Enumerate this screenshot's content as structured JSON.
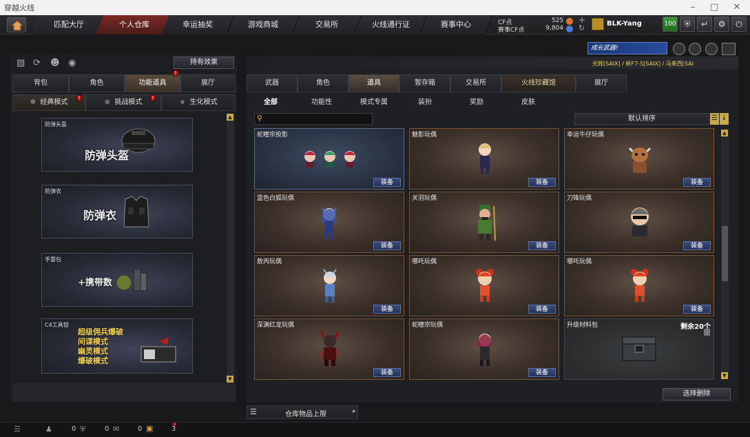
{
  "window": {
    "title": "穿越火线"
  },
  "topnav": {
    "tabs": [
      {
        "label": "匹配大厅"
      },
      {
        "label": "个人仓库"
      },
      {
        "label": "幸运抽奖"
      },
      {
        "label": "游戏商城"
      },
      {
        "label": "交易所"
      },
      {
        "label": "火线通行证"
      },
      {
        "label": "赛事中心"
      }
    ],
    "cf_label": "CF点",
    "cf_value": "525",
    "match_cf_label": "赛事CF点",
    "match_cf_value": "9,804",
    "username": "BLK-Yang",
    "level_badge": "100"
  },
  "left": {
    "effect_button": "持有效果",
    "tabs": [
      {
        "label": "背包"
      },
      {
        "label": "角色"
      },
      {
        "label": "功能道具"
      },
      {
        "label": "展厅"
      }
    ],
    "modes": [
      {
        "label": "经典模式"
      },
      {
        "label": "挑战模式"
      },
      {
        "label": "生化模式"
      }
    ],
    "items": [
      {
        "caption": "防弹头盔",
        "title": "防弹头盔"
      },
      {
        "caption": "防弹衣",
        "title": "防弹衣"
      },
      {
        "caption": "手雷包",
        "title": "+携带数"
      },
      {
        "caption": "C4工具钳",
        "lines": [
          "超级佣兵爆破",
          "间谍模式",
          "幽灵模式",
          "爆破模式"
        ]
      }
    ]
  },
  "right": {
    "banner_text": "成长武器!",
    "ticker": "光辉[SAIX] / 新F7-S[SAIX] / 马来西[SAI",
    "tabs": [
      {
        "label": "武器"
      },
      {
        "label": "角色"
      },
      {
        "label": "道具"
      },
      {
        "label": "暂存箱"
      },
      {
        "label": "交易所"
      },
      {
        "label": "火线珍藏馆"
      },
      {
        "label": "展厅"
      }
    ],
    "subtabs": [
      {
        "label": "全部"
      },
      {
        "label": "功能性"
      },
      {
        "label": "模式专属"
      },
      {
        "label": "装扮"
      },
      {
        "label": "奖励"
      },
      {
        "label": "皮肤"
      }
    ],
    "sort_label": "默认排序",
    "equip_label": "装备",
    "items": [
      {
        "name": "蛇瞳宗投影",
        "style": "blue"
      },
      {
        "name": "魅影玩偶",
        "style": "brown"
      },
      {
        "name": "幸运牛仔玩偶",
        "style": "brown"
      },
      {
        "name": "蓝色白狐玩偶",
        "style": "brown"
      },
      {
        "name": "关羽玩偶",
        "style": "brown"
      },
      {
        "name": "刀锋玩偶",
        "style": "brown"
      },
      {
        "name": "敖丙玩偶",
        "style": "brown"
      },
      {
        "name": "哪吒玩偶",
        "style": "brown"
      },
      {
        "name": "哪吒玩偶",
        "style": "brown"
      },
      {
        "name": "深渊红龙玩偶",
        "style": "brown"
      },
      {
        "name": "蛇瞳宗玩偶",
        "style": "brown"
      },
      {
        "name": "升级材料包",
        "style": "gray",
        "remaining": "剩余20个"
      }
    ],
    "delete_button": "选择删除",
    "capacity_label": "仓库物品上限"
  },
  "statusbar": {
    "count1": "0",
    "count2": "0",
    "count3": "0",
    "count4": "3"
  },
  "colors": {
    "accent_red": "#7a2a24",
    "equip_blue": "#3c4d7a",
    "card_border": "#7a5535"
  }
}
